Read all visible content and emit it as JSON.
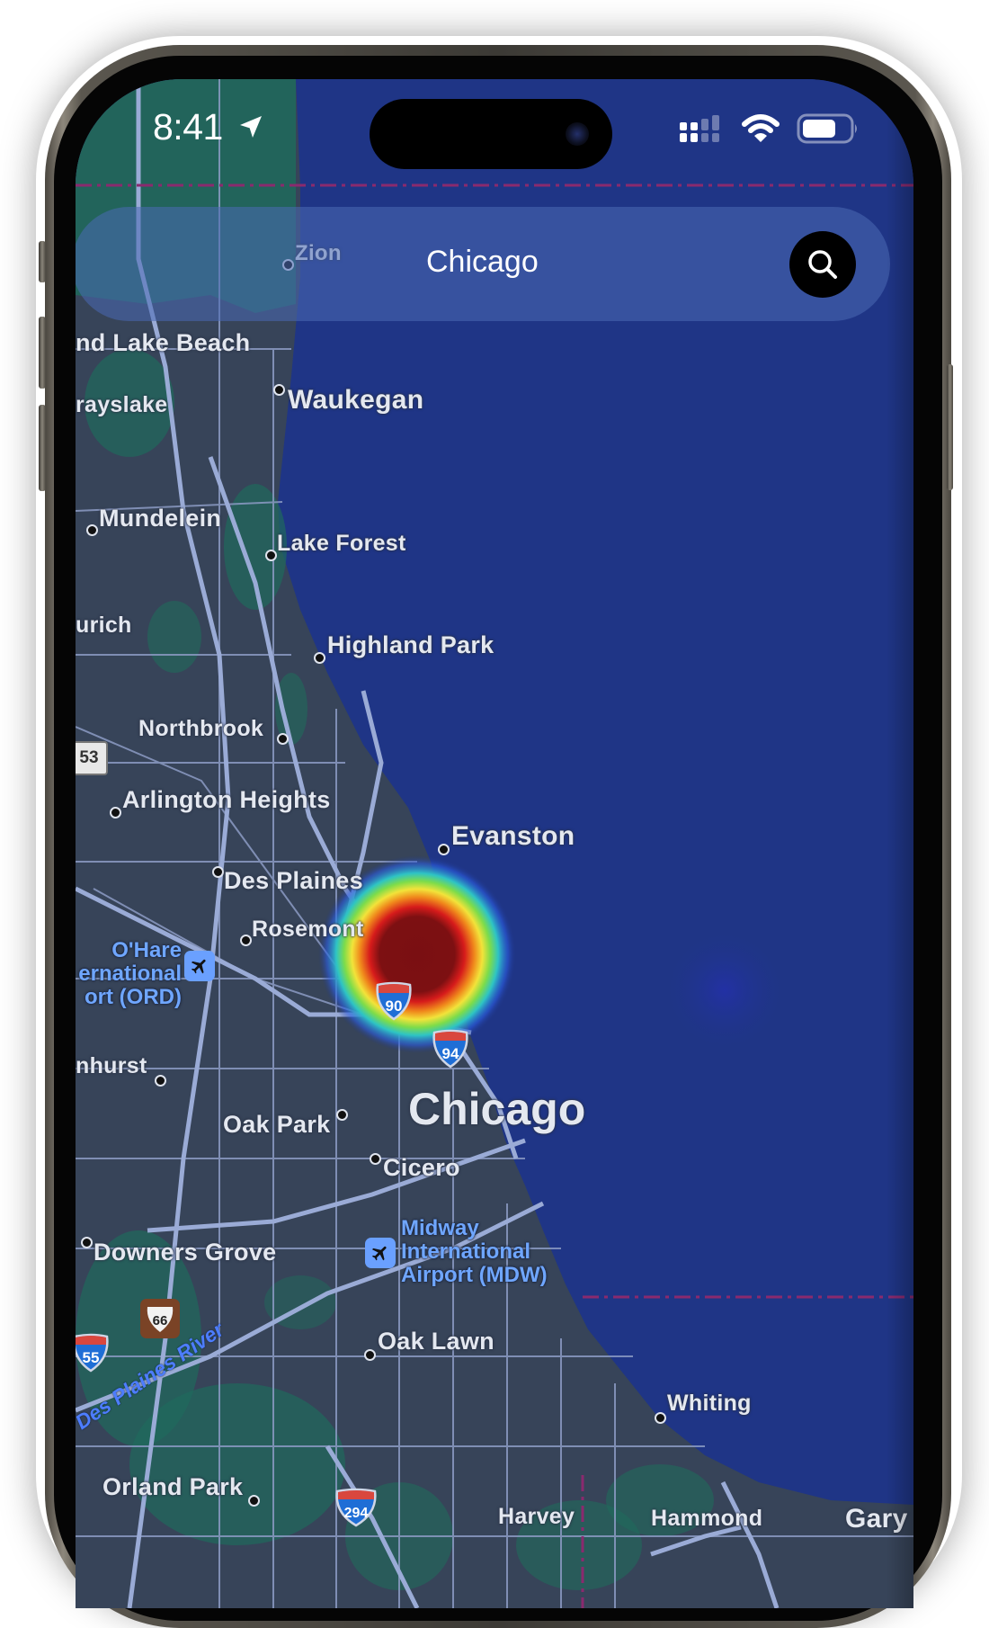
{
  "status_bar": {
    "time": "8:41",
    "location_icon": "location-arrow-icon",
    "signal_icon": "cellular-signal-icon",
    "wifi_icon": "wifi-icon",
    "battery_icon": "battery-icon"
  },
  "search": {
    "query": "Chicago",
    "button_icon": "search-icon"
  },
  "map": {
    "colors": {
      "water": "#1f3586",
      "land": "#374459",
      "park": "#1f6a5c",
      "road": "#8c9bc4",
      "border": "#8a2a6e",
      "airport_label": "#6fa6ff"
    },
    "places": [
      {
        "id": "zion",
        "name": "Zion"
      },
      {
        "id": "lake-beach",
        "name": "nd Lake Beach"
      },
      {
        "id": "waukegan",
        "name": "Waukegan"
      },
      {
        "id": "grayslake",
        "name": "rayslake"
      },
      {
        "id": "mundelein",
        "name": "Mundelein"
      },
      {
        "id": "lake-forest",
        "name": "Lake Forest"
      },
      {
        "id": "zurich",
        "name": "urich"
      },
      {
        "id": "highland-park",
        "name": "Highland Park"
      },
      {
        "id": "northbrook",
        "name": "Northbrook"
      },
      {
        "id": "arlington-heights",
        "name": "Arlington Heights"
      },
      {
        "id": "evanston",
        "name": "Evanston"
      },
      {
        "id": "des-plaines",
        "name": "Des Plaines"
      },
      {
        "id": "rosemont",
        "name": "Rosemont"
      },
      {
        "id": "elmhurst",
        "name": "nhurst"
      },
      {
        "id": "chicago",
        "name": "Chicago"
      },
      {
        "id": "oak-park",
        "name": "Oak Park"
      },
      {
        "id": "cicero",
        "name": "Cicero"
      },
      {
        "id": "downers-grove",
        "name": "Downers Grove"
      },
      {
        "id": "oak-lawn",
        "name": "Oak Lawn"
      },
      {
        "id": "whiting",
        "name": "Whiting"
      },
      {
        "id": "orland-park",
        "name": "Orland Park"
      },
      {
        "id": "harvey",
        "name": "Harvey"
      },
      {
        "id": "hammond",
        "name": "Hammond"
      },
      {
        "id": "gary",
        "name": "Gary"
      }
    ],
    "airports": [
      {
        "id": "ohare",
        "lines": [
          "O'Hare",
          "ernational",
          "ort (ORD)"
        ],
        "icon": "airplane-icon"
      },
      {
        "id": "midway",
        "lines": [
          "Midway",
          "International",
          "Airport (MDW)"
        ],
        "icon": "airplane-icon"
      }
    ],
    "highway_shields": [
      {
        "id": "us-53",
        "number": "53",
        "type": "state"
      },
      {
        "id": "i-90",
        "number": "90",
        "type": "interstate"
      },
      {
        "id": "i-94",
        "number": "94",
        "type": "interstate"
      },
      {
        "id": "us-66",
        "number": "66",
        "type": "us-historic"
      },
      {
        "id": "i-55",
        "number": "55",
        "type": "interstate"
      },
      {
        "id": "i-294",
        "number": "294",
        "type": "interstate"
      }
    ],
    "water_labels": [
      {
        "id": "des-plaines-river",
        "name": "Des Plaines River"
      }
    ],
    "heatmap": {
      "hotspots": [
        {
          "near": "Chicago north side (west of Evanston)",
          "intensity": "high"
        },
        {
          "near": "Lake Michigan offshore",
          "intensity": "very low"
        }
      ],
      "color_scale": [
        "#1f3586",
        "#2a5be0",
        "#2ec4c4",
        "#7ddc4a",
        "#f2e33a",
        "#f08a1c",
        "#e01f1f",
        "#7a0f12"
      ]
    }
  }
}
